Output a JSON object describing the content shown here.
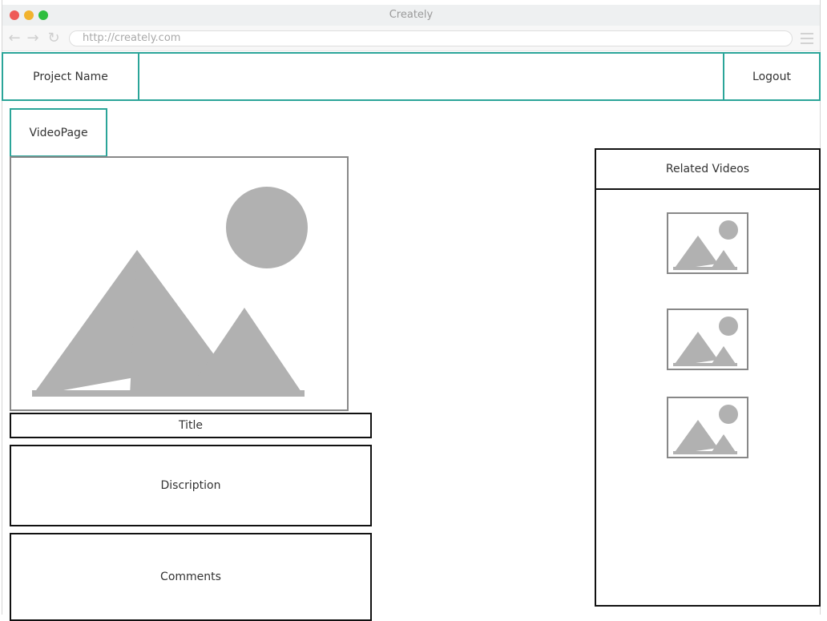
{
  "browser": {
    "title": "Creately",
    "url": "http://creately.com"
  },
  "header": {
    "project_name": "Project Name",
    "logout": "Logout"
  },
  "tab": {
    "label": "VideoPage"
  },
  "video": {
    "title_label": "Title",
    "description_label": "Discription",
    "comments_label": "Comments"
  },
  "related": {
    "heading": "Related Videos",
    "thumbnails": [
      "image-placeholder",
      "image-placeholder",
      "image-placeholder"
    ]
  },
  "colors": {
    "accent": "#2ba599",
    "placeholder_gray": "#b1b1b1"
  }
}
